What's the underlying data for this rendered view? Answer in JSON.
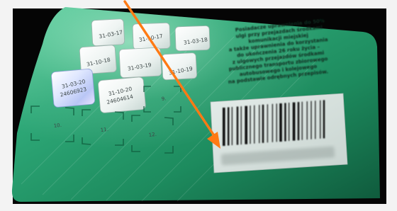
{
  "card": {
    "base_color": "#1f8e62",
    "light_color": "#57c998",
    "dark_color": "#0d4f35"
  },
  "annotation": {
    "arrow_color": "#ff7a14"
  },
  "validation_stickers": [
    {
      "date": "31-03-17",
      "code": ""
    },
    {
      "date": "31-10-17",
      "code": ""
    },
    {
      "date": "31-03-18",
      "code": ""
    },
    {
      "date": "31-10-18",
      "code": ""
    },
    {
      "date": "31-03-19",
      "code": ""
    },
    {
      "date": "31-10-19",
      "code": ""
    },
    {
      "date": "31-03-20",
      "code": "24606923"
    },
    {
      "date": "31-10-20",
      "code": "24604614"
    }
  ],
  "empty_slots": [
    "10.",
    "11.",
    "12.",
    "9."
  ],
  "legal_text": {
    "lines": [
      "Posiadacze uprawnienia do 50%",
      "ulgi przy przejazdach środkami",
      "komunikacji miejskiej",
      "a także uprawnienia do korzystania",
      "do ukończenia 26 roku życia –",
      "z ulgowych przejazdów środkami",
      "publicznego transportu zbiorowego",
      "autobusowego i kolejowego",
      "na podstawie odrębnych przepisów."
    ]
  }
}
